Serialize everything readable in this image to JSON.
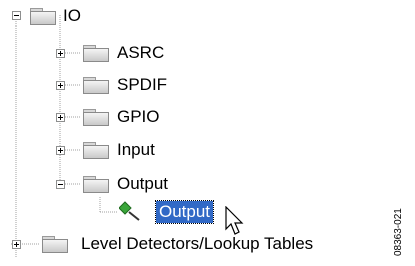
{
  "tree": {
    "root": {
      "label": "IO",
      "expanded": true,
      "icon": "folder-icon"
    },
    "children": [
      {
        "label": "ASRC",
        "expanded": false,
        "icon": "folder-icon"
      },
      {
        "label": "SPDIF",
        "expanded": false,
        "icon": "folder-icon"
      },
      {
        "label": "GPIO",
        "expanded": false,
        "icon": "folder-icon"
      },
      {
        "label": "Input",
        "expanded": false,
        "icon": "folder-icon"
      },
      {
        "label": "Output",
        "expanded": true,
        "icon": "folder-icon",
        "children": [
          {
            "label": "Output",
            "selected": true,
            "icon": "output-block-icon"
          }
        ]
      }
    ],
    "sibling": {
      "label": "Level Detectors/Lookup Tables",
      "expanded": false,
      "icon": "folder-icon"
    }
  },
  "colors": {
    "selection": "#3169c6",
    "icon_green": "#3aa63a"
  },
  "figure_id": "08363-021"
}
